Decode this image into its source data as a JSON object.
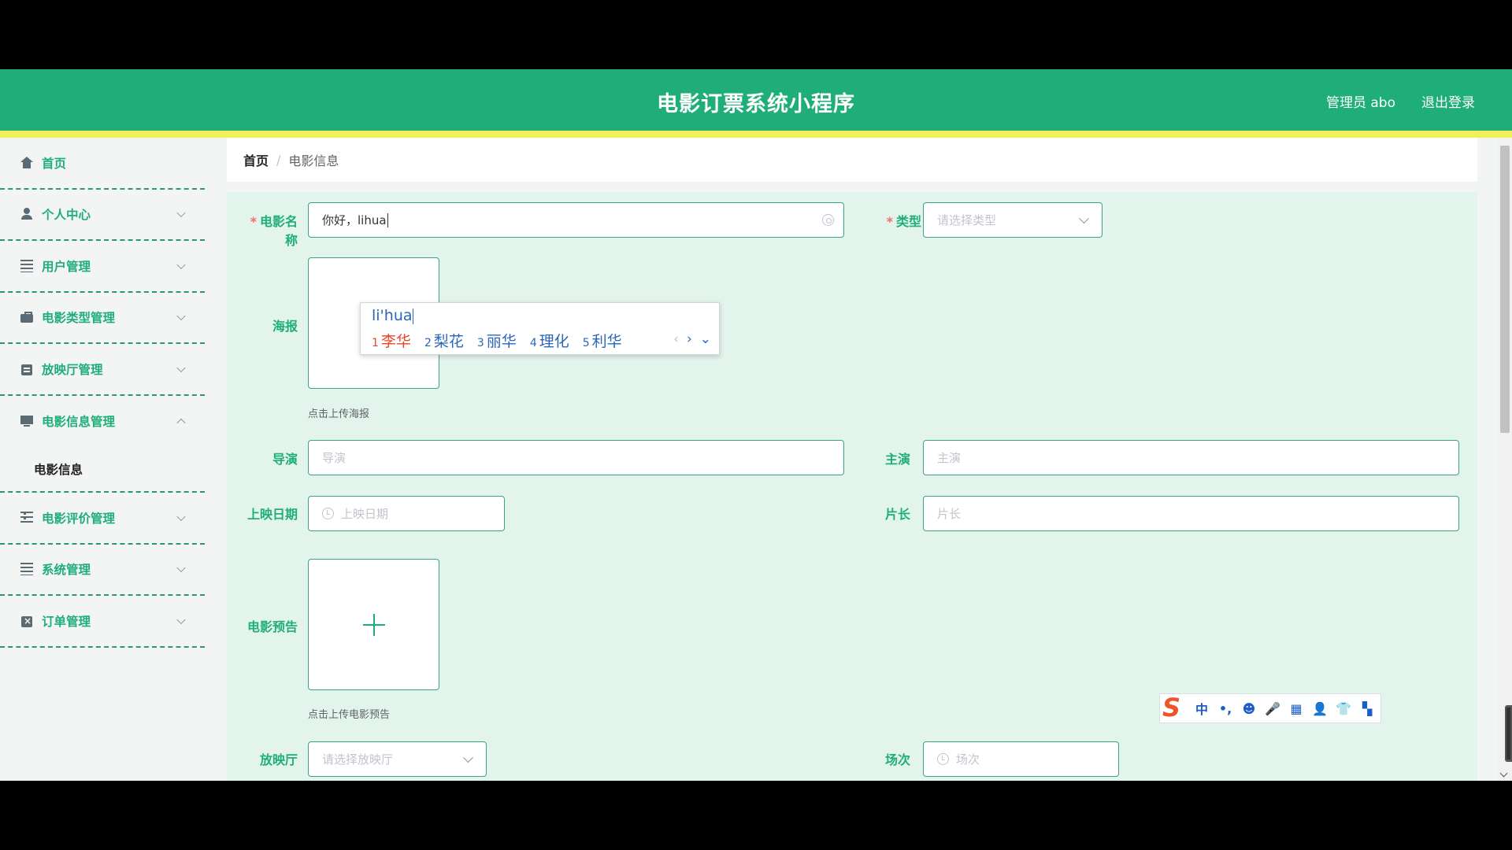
{
  "header": {
    "title": "电影订票系统小程序",
    "user": "管理员 abo",
    "logout": "退出登录"
  },
  "sidebar": {
    "items": [
      {
        "label": "首页",
        "icon": "home-icon"
      },
      {
        "label": "个人中心",
        "icon": "user-icon"
      },
      {
        "label": "用户管理",
        "icon": "list-icon"
      },
      {
        "label": "电影类型管理",
        "icon": "briefcase-icon"
      },
      {
        "label": "放映厅管理",
        "icon": "clipboard-icon"
      },
      {
        "label": "电影信息管理",
        "icon": "monitor-icon",
        "expanded": true
      },
      {
        "label": "电影评价管理",
        "icon": "sliders-icon"
      },
      {
        "label": "系统管理",
        "icon": "list-icon"
      },
      {
        "label": "订单管理",
        "icon": "order-icon"
      }
    ],
    "submenu": {
      "label": "电影信息"
    }
  },
  "breadcrumb": {
    "home": "首页",
    "separator": "/",
    "current": "电影信息"
  },
  "form": {
    "name": {
      "label": "电影名称",
      "value": "你好，lihua"
    },
    "type": {
      "label": "类型",
      "placeholder": "请选择类型"
    },
    "poster": {
      "label": "海报",
      "tip": "点击上传海报"
    },
    "director": {
      "label": "导演",
      "placeholder": "导演"
    },
    "actors": {
      "label": "主演",
      "placeholder": "主演"
    },
    "release_date": {
      "label": "上映日期",
      "placeholder": "上映日期"
    },
    "duration": {
      "label": "片长",
      "placeholder": "片长"
    },
    "trailer": {
      "label": "电影预告",
      "tip": "点击上传电影预告"
    },
    "hall": {
      "label": "放映厅",
      "placeholder": "请选择放映厅"
    },
    "session": {
      "label": "场次",
      "placeholder": "场次"
    }
  },
  "ime": {
    "pinyin": "li'hua",
    "candidates": [
      {
        "n": "1",
        "text": "李华"
      },
      {
        "n": "2",
        "text": "梨花"
      },
      {
        "n": "3",
        "text": "丽华"
      },
      {
        "n": "4",
        "text": "理化"
      },
      {
        "n": "5",
        "text": "利华"
      }
    ],
    "prev": "‹",
    "next": "›",
    "more": "⌄"
  },
  "sogou_toolbar": {
    "mode": "中",
    "punct": "•,",
    "emoji": "☻",
    "voice": "🎤",
    "keyboard": "▦",
    "user": "👤",
    "skin": "👕",
    "apps": "▚"
  },
  "colors": {
    "header": "#1fae7a",
    "accent_bar": "#f2f05a",
    "panel": "#e3f4ec",
    "required": "#f56c6c"
  }
}
